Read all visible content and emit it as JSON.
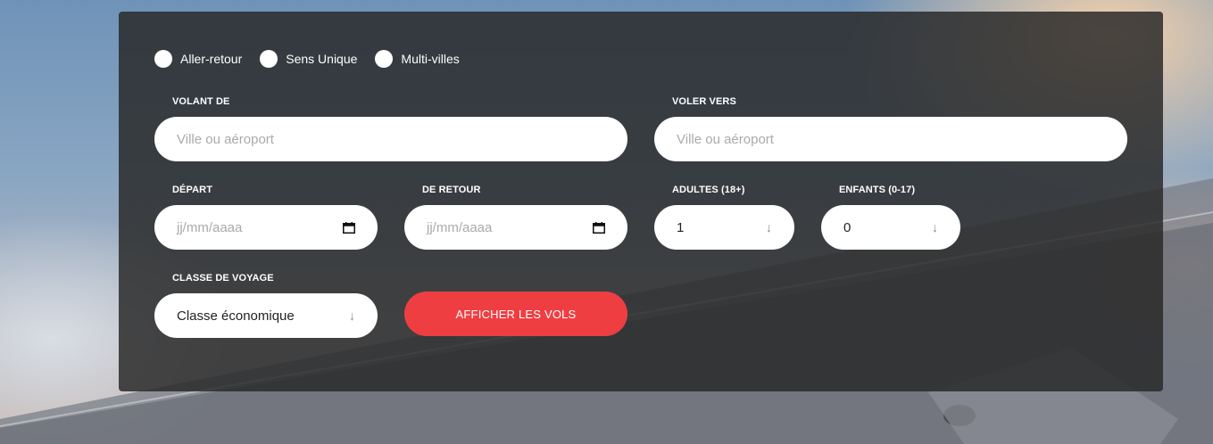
{
  "trip_type": {
    "options": [
      "Aller-retour",
      "Sens Unique",
      "Multi-villes"
    ]
  },
  "from": {
    "label": "VOLANT DE",
    "placeholder": "Ville ou aéroport"
  },
  "to": {
    "label": "VOLER VERS",
    "placeholder": "Ville ou aéroport"
  },
  "departure": {
    "label": "DÉPART",
    "placeholder": "jj/mm/aaaa"
  },
  "return": {
    "label": "DE RETOUR",
    "placeholder": "jj/mm/aaaa"
  },
  "adults": {
    "label": "ADULTES (18+)",
    "value": "1"
  },
  "children": {
    "label": "ENFANTS (0-17)",
    "value": "0"
  },
  "travel_class": {
    "label": "CLASSE DE VOYAGE",
    "value": "Classe économique"
  },
  "submit": {
    "label": "AFFICHER LES VOLS"
  },
  "colors": {
    "accent": "#ef3e42",
    "panel": "#282828"
  },
  "icons": {
    "date": "calendar-icon",
    "select": "arrow-down-icon"
  }
}
